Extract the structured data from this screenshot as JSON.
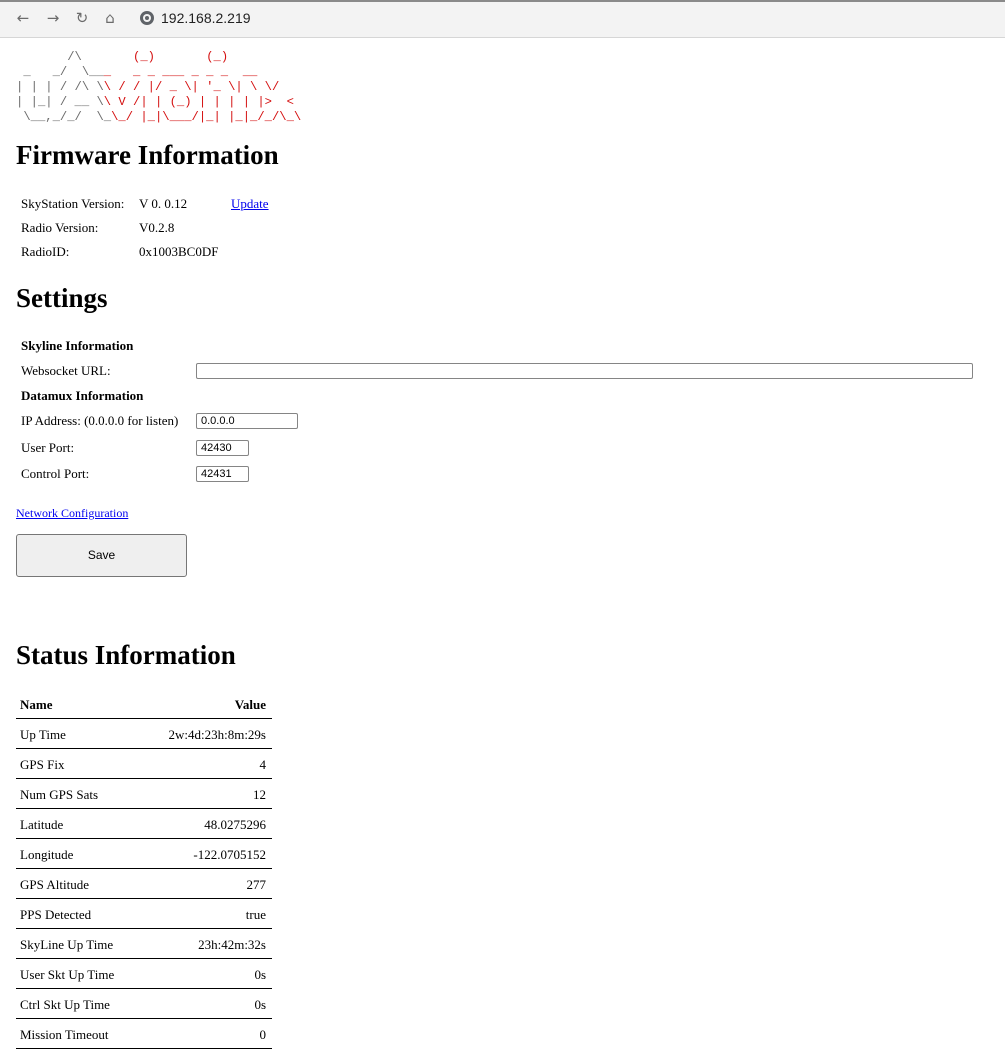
{
  "browser": {
    "address": "192.168.2.219"
  },
  "logo": {
    "text": "uAvionix"
  },
  "firmware": {
    "title": "Firmware Information",
    "skystation_label": "SkyStation Version:",
    "skystation_value": "V 0. 0.12",
    "update_link": "Update",
    "radio_label": "Radio Version:",
    "radio_value": "V0.2.8",
    "radioid_label": "RadioID:",
    "radioid_value": "0x1003BC0DF"
  },
  "settings": {
    "title": "Settings",
    "skyline_heading": "Skyline Information",
    "websocket_label": "Websocket URL:",
    "websocket_value": "",
    "datamux_heading": "Datamux Information",
    "ip_label": "IP Address: (0.0.0.0 for listen)",
    "ip_value": "0.0.0.0",
    "user_port_label": "User Port:",
    "user_port_value": "42430",
    "control_port_label": "Control Port:",
    "control_port_value": "42431",
    "network_link": "Network Configuration",
    "save_label": "Save"
  },
  "status": {
    "title": "Status Information",
    "header": {
      "name": "Name",
      "value": "Value"
    },
    "rows": [
      {
        "name": "Up Time",
        "value": "2w:4d:23h:8m:29s"
      },
      {
        "name": "GPS Fix",
        "value": "4"
      },
      {
        "name": "Num GPS Sats",
        "value": "12"
      },
      {
        "name": "Latitude",
        "value": "48.0275296"
      },
      {
        "name": "Longitude",
        "value": "-122.0705152"
      },
      {
        "name": "GPS Altitude",
        "value": "277"
      },
      {
        "name": "PPS Detected",
        "value": "true"
      },
      {
        "name": "SkyLine Up Time",
        "value": "23h:42m:32s"
      },
      {
        "name": "User Skt Up Time",
        "value": "0s"
      },
      {
        "name": "Ctrl Skt Up Time",
        "value": "0s"
      },
      {
        "name": "Mission Timeout",
        "value": "0"
      }
    ]
  }
}
